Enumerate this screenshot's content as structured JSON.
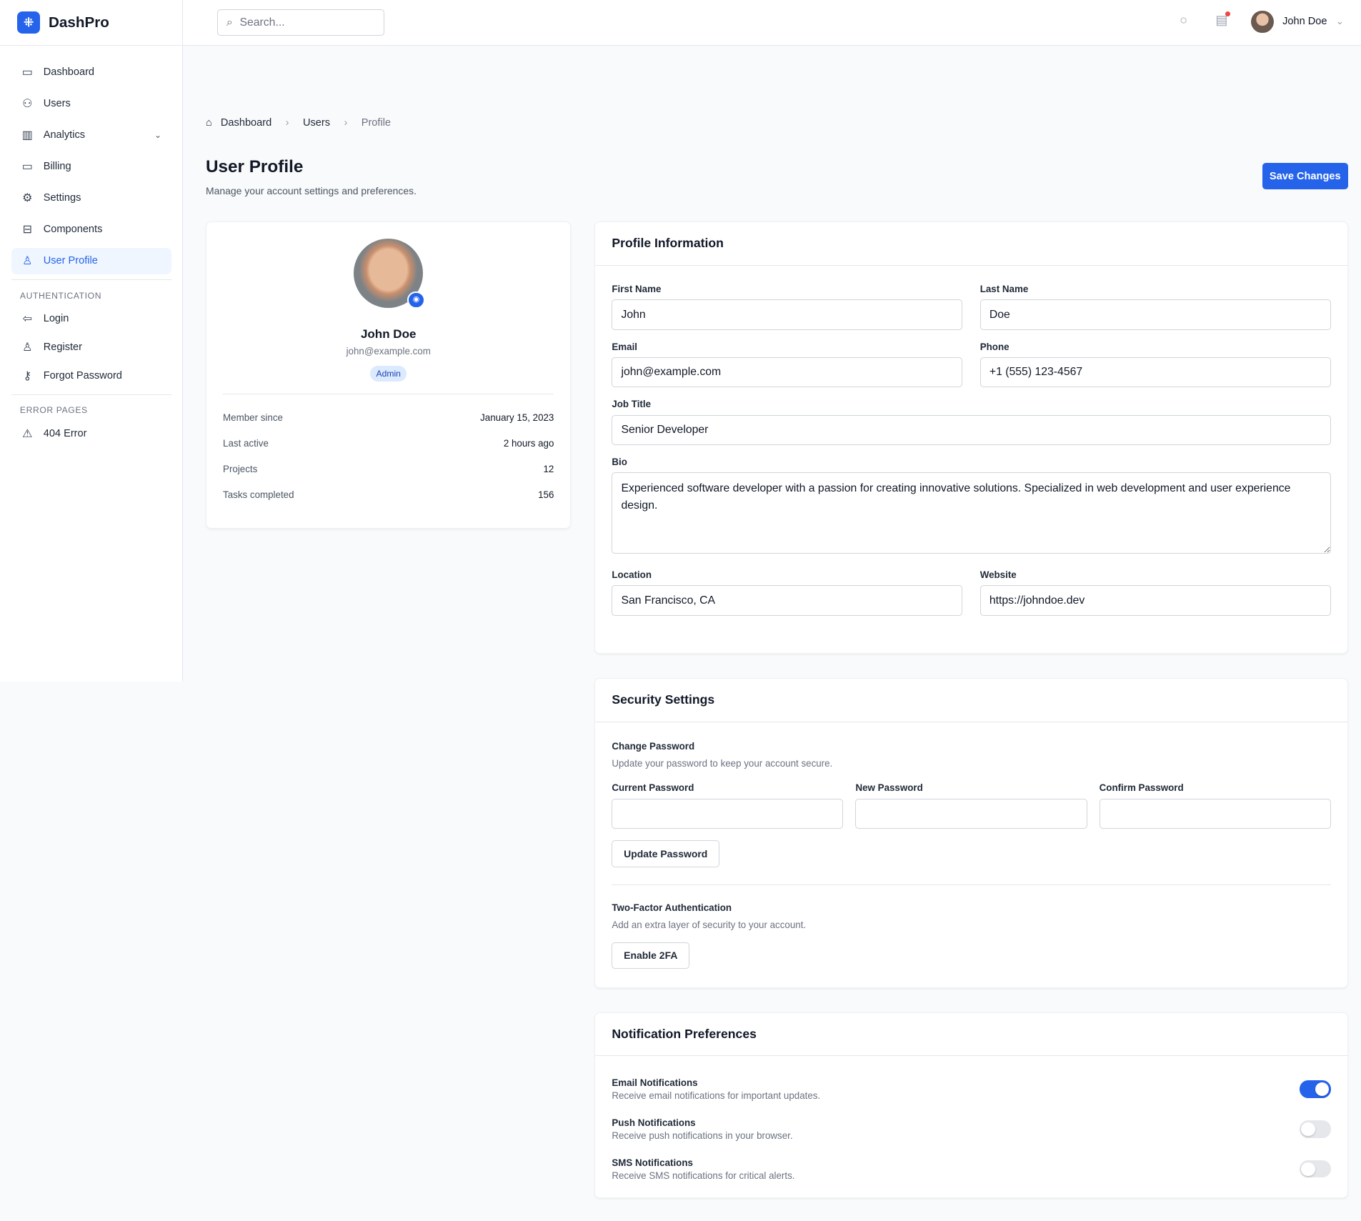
{
  "app": {
    "name": "DashPro"
  },
  "sidebar": {
    "items": [
      {
        "label": "Dashboard",
        "icon": "briefcase-icon"
      },
      {
        "label": "Users",
        "icon": "users-icon"
      },
      {
        "label": "Analytics",
        "icon": "bar-chart-icon"
      },
      {
        "label": "Billing",
        "icon": "credit-card-icon"
      },
      {
        "label": "Settings",
        "icon": "gear-icon"
      },
      {
        "label": "Components",
        "icon": "box-icon"
      },
      {
        "label": "User Profile",
        "icon": "user-icon"
      }
    ],
    "auth_heading": "AUTHENTICATION",
    "auth_items": [
      {
        "label": "Login"
      },
      {
        "label": "Register"
      },
      {
        "label": "Forgot Password"
      }
    ],
    "error_heading": "ERROR PAGES",
    "error_items": [
      {
        "label": "404 Error"
      }
    ]
  },
  "topbar": {
    "search_placeholder": "Search...",
    "user_name": "John Doe"
  },
  "breadcrumb": [
    "Dashboard",
    "Users",
    "Profile"
  ],
  "page": {
    "title": "User Profile",
    "subtitle": "Manage your account settings and preferences.",
    "save_label": "Save Changes"
  },
  "profile_card": {
    "name": "John Doe",
    "email": "john@example.com",
    "role": "Admin",
    "stats": [
      {
        "label": "Member since",
        "value": "January 15, 2023"
      },
      {
        "label": "Last active",
        "value": "2 hours ago"
      },
      {
        "label": "Projects",
        "value": "12"
      },
      {
        "label": "Tasks completed",
        "value": "156"
      }
    ]
  },
  "profile_info": {
    "title": "Profile Information",
    "first_name": {
      "label": "First Name",
      "value": "John"
    },
    "last_name": {
      "label": "Last Name",
      "value": "Doe"
    },
    "email": {
      "label": "Email",
      "value": "john@example.com"
    },
    "phone": {
      "label": "Phone",
      "value": "+1 (555) 123-4567"
    },
    "job_title": {
      "label": "Job Title",
      "value": "Senior Developer"
    },
    "bio": {
      "label": "Bio",
      "value": "Experienced software developer with a passion for creating innovative solutions. Specialized in web development and user experience design."
    },
    "location": {
      "label": "Location",
      "value": "San Francisco, CA"
    },
    "website": {
      "label": "Website",
      "value": "https://johndoe.dev"
    }
  },
  "security": {
    "title": "Security Settings",
    "change_title": "Change Password",
    "change_desc": "Update your password to keep your account secure.",
    "current_label": "Current Password",
    "new_label": "New Password",
    "confirm_label": "Confirm Password",
    "update_label": "Update Password",
    "tfa_title": "Two-Factor Authentication",
    "tfa_desc": "Add an extra layer of security to your account.",
    "tfa_button": "Enable 2FA"
  },
  "notifications": {
    "title": "Notification Preferences",
    "items": [
      {
        "title": "Email Notifications",
        "desc": "Receive email notifications for important updates.",
        "enabled": true
      },
      {
        "title": "Push Notifications",
        "desc": "Receive push notifications in your browser.",
        "enabled": false
      },
      {
        "title": "SMS Notifications",
        "desc": "Receive SMS notifications for critical alerts.",
        "enabled": false
      }
    ]
  },
  "colors": {
    "accent": "#2563eb",
    "badge": "#dbeafe",
    "notification_dot": "#ef4444"
  }
}
